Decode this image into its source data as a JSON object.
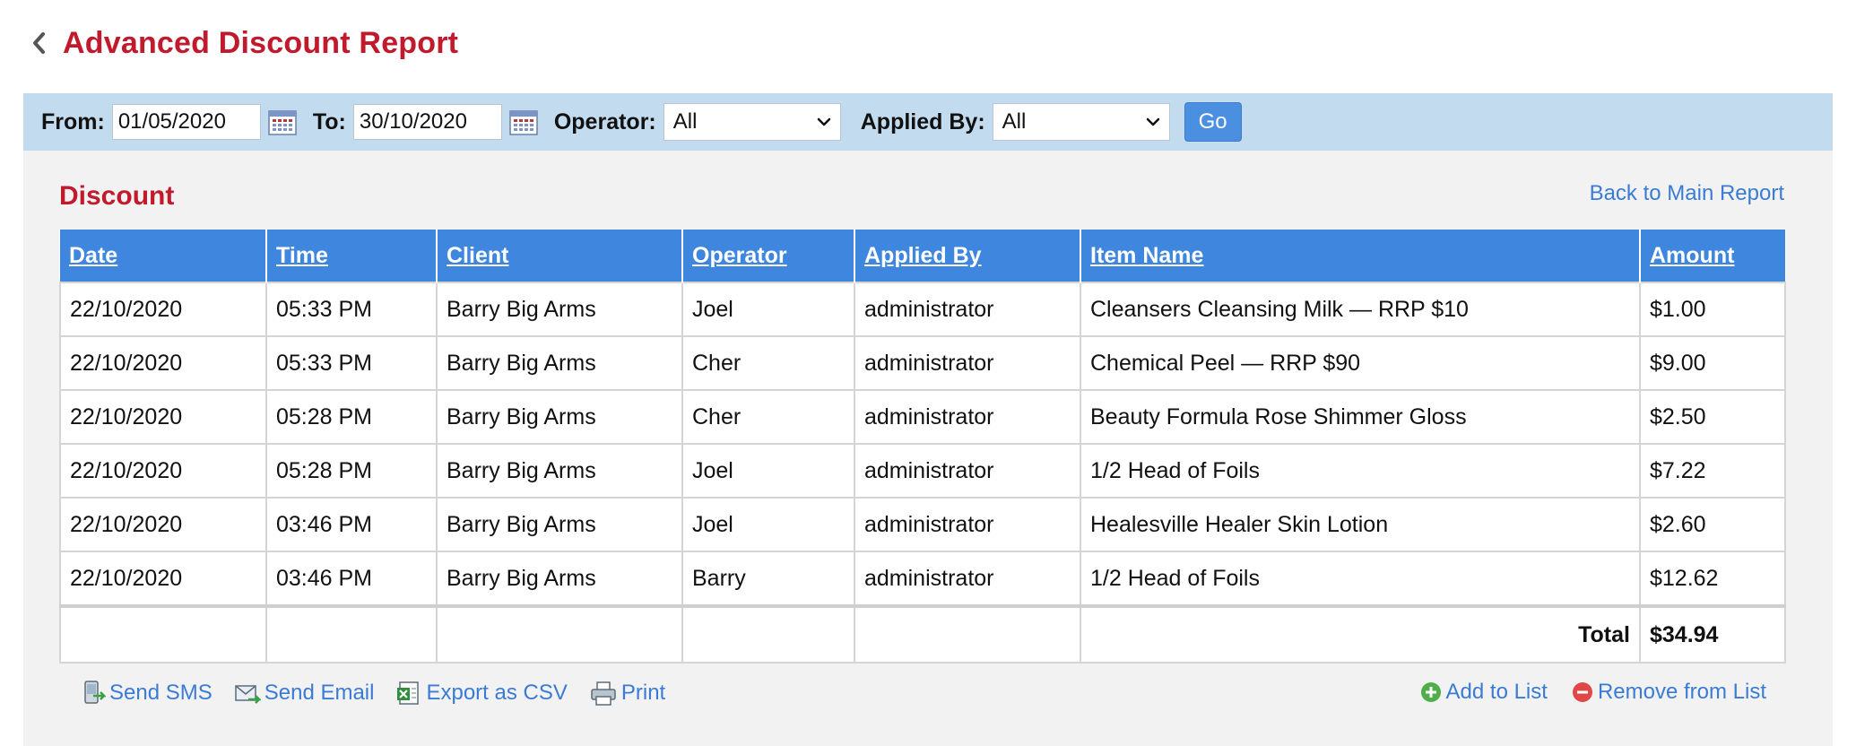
{
  "header": {
    "title": "Advanced Discount Report"
  },
  "filters": {
    "from_label": "From:",
    "from_value": "01/05/2020",
    "to_label": "To:",
    "to_value": "30/10/2020",
    "operator_label": "Operator:",
    "operator_value": "All",
    "applied_by_label": "Applied By:",
    "applied_by_value": "All",
    "go_label": "Go"
  },
  "section": {
    "title": "Discount",
    "back_link": "Back to Main Report"
  },
  "table": {
    "columns": [
      "Date",
      "Time",
      "Client",
      "Operator",
      "Applied By",
      "Item Name",
      "Amount"
    ],
    "rows": [
      [
        "22/10/2020",
        "05:33 PM",
        "Barry Big Arms",
        "Joel",
        "administrator",
        "Cleansers Cleansing Milk — RRP $10",
        "$1.00"
      ],
      [
        "22/10/2020",
        "05:33 PM",
        "Barry Big Arms",
        "Cher",
        "administrator",
        "Chemical Peel — RRP $90",
        "$9.00"
      ],
      [
        "22/10/2020",
        "05:28 PM",
        "Barry Big Arms",
        "Cher",
        "administrator",
        "Beauty Formula Rose Shimmer Gloss",
        "$2.50"
      ],
      [
        "22/10/2020",
        "05:28 PM",
        "Barry Big Arms",
        "Joel",
        "administrator",
        "1/2 Head of Foils",
        "$7.22"
      ],
      [
        "22/10/2020",
        "03:46 PM",
        "Barry Big Arms",
        "Joel",
        "administrator",
        "Healesville Healer Skin Lotion",
        "$2.60"
      ],
      [
        "22/10/2020",
        "03:46 PM",
        "Barry Big Arms",
        "Barry",
        "administrator",
        "1/2 Head of Foils",
        "$12.62"
      ]
    ],
    "total_label": "Total",
    "total_value": "$34.94"
  },
  "actions": {
    "send_sms": "Send SMS",
    "send_email": "Send Email",
    "export_csv": "Export as CSV",
    "print": "Print",
    "add_to_list": "Add to List",
    "remove_from_list": "Remove from List"
  },
  "colors": {
    "title_red": "#c01a2c",
    "header_blue": "#3f86df",
    "filter_bar": "#c3dbee",
    "link_blue": "#3a7bd5",
    "go_button": "#4b8fe0"
  },
  "icons": {
    "back": "chevron-left-icon",
    "calendar": "calendar-icon",
    "select": "chevron-down-icon",
    "sms": "phone-icon",
    "email": "envelope-icon",
    "csv": "spreadsheet-icon",
    "print": "printer-icon",
    "add": "plus-circle-icon",
    "remove": "minus-circle-icon"
  }
}
